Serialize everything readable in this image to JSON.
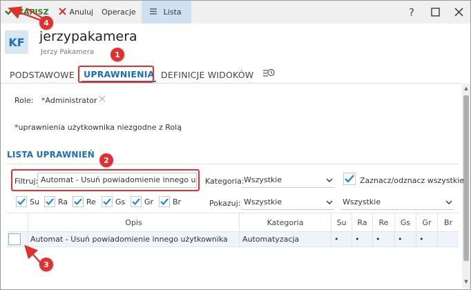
{
  "toolbar": {
    "save_label": "ZAPISZ",
    "cancel_label": "Anuluj",
    "operations_label": "Operacje",
    "list_label": "Lista",
    "help_symbol": "?",
    "save_icon": "check-icon",
    "cancel_icon": "close-icon",
    "list_icon": "hamburger-icon"
  },
  "header": {
    "avatar": "KF",
    "username": "jerzypakamera",
    "full_name": "Jerzy Pakamera"
  },
  "tabs": [
    {
      "label": "PODSTAWOWE"
    },
    {
      "label": "UPRAWNIENIA"
    },
    {
      "label": "DEFINICJE WIDOKÓW"
    }
  ],
  "role": {
    "label": "Role:",
    "value": "*Administrator"
  },
  "note": "*uprawnienia użytkownika niezgodne z Rolą",
  "section_title": "LISTA UPRAWNIEŃ",
  "filter": {
    "label": "Filtruj:",
    "value": "Automat - Usuń powiadomienie innego użytkownika",
    "category_label": "Kategoria:",
    "category_value": "Wszystkie",
    "toggle_all_label": "Zaznacz/odznacz wszystkie",
    "show_label": "Pokazuj:",
    "show_value_1": "Wszystkie",
    "show_value_2": "Wszystkie"
  },
  "column_toggles": [
    "Su",
    "Ra",
    "Re",
    "Gs",
    "Gr",
    "Br"
  ],
  "table": {
    "headers": [
      "Opis",
      "Kategoria",
      "Su",
      "Ra",
      "Re",
      "Gs",
      "Gr",
      "Br"
    ],
    "rows": [
      {
        "description": "Automat - Usuń powiadomienie innego użytkownika",
        "category": "Automatyzacja",
        "flags": [
          "•",
          "•",
          "•",
          "•",
          "•",
          ""
        ]
      }
    ]
  },
  "annotations": [
    "1",
    "2",
    "3",
    "4"
  ],
  "colors": {
    "accent": "#1b6fb5",
    "save_green": "#2d7d2d",
    "annotation_red": "#e03030",
    "check_blue": "#1b8ad8"
  }
}
